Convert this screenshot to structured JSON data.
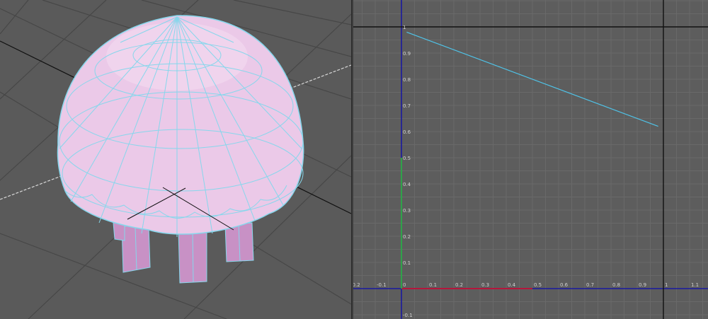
{
  "viewport": {
    "object_name": "jellyfish-mesh",
    "colors": {
      "background": "#5a5a5a",
      "grid": "#474747",
      "mesh_fill": "#ebc9e8",
      "mesh_wire": "#86d7ec",
      "leg_fill": "#c891c5"
    }
  },
  "graph_editor": {
    "colors": {
      "background": "#5d5d5d",
      "grid": "#696969",
      "x_axis": "#1a1aa0",
      "y_axis": "#1a1aa0",
      "frame_lines": "#111111",
      "curve": "#4fc3e8",
      "x_positive": "#b4163c",
      "y_positive": "#2fa24a"
    },
    "x_ticks": [
      "-0.2",
      "-0.1",
      "0",
      "0.1",
      "0.2",
      "0.3",
      "0.4",
      "0.5",
      "0.6",
      "0.7",
      "0.8",
      "0.9",
      "1",
      "1.1"
    ],
    "y_ticks": [
      "1",
      "0.9",
      "0.8",
      "0.7",
      "0.6",
      "0.5",
      "0.4",
      "0.3",
      "0.2",
      "0.1",
      "-0.1"
    ],
    "curve_points": [
      [
        0.02,
        0.98
      ],
      [
        0.98,
        0.62
      ]
    ]
  }
}
